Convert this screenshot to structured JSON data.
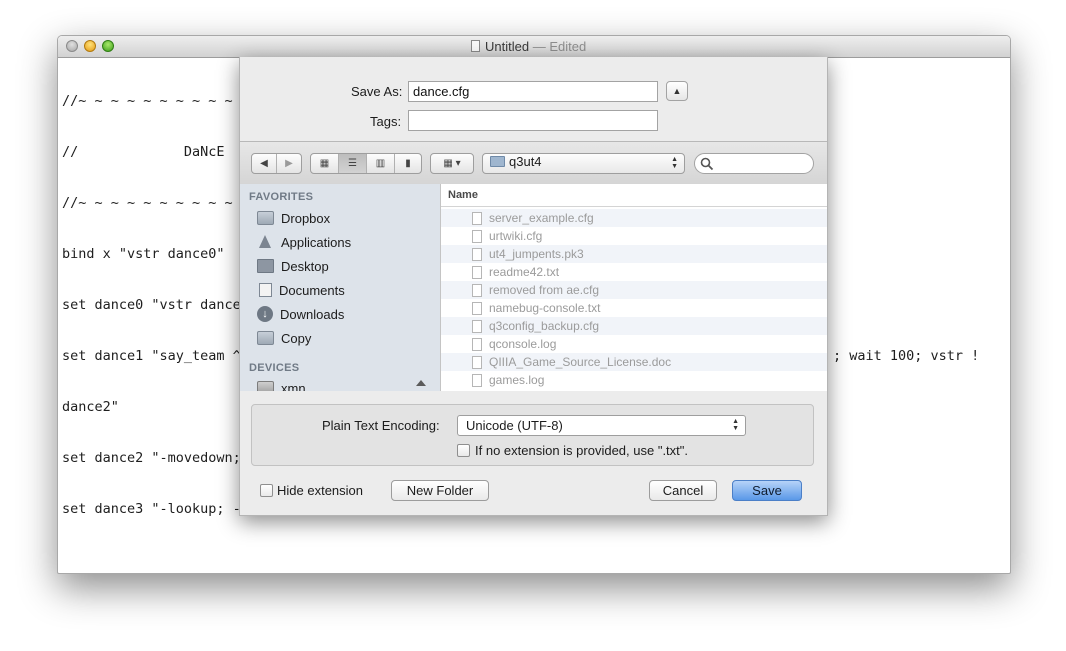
{
  "window": {
    "title": "Untitled",
    "title_separator": "—",
    "title_status": "Edited"
  },
  "editor": {
    "lines": [
      "//~ ~ ~ ~ ~ ~ ~ ~ ~ ~",
      "//             DaNcE",
      "//~ ~ ~ ~ ~ ~ ~ ~ ~ ~",
      "bind x \"vstr dance0\"",
      "set dance0 \"vstr dance",
      "set dance1 \"say_team ^",
      "dance2\"",
      "set dance2 \"-movedown;",
      "set dance3 \"-lookup; -"
    ],
    "dance1_tail": "; wait 100; vstr !"
  },
  "save_sheet": {
    "save_as_label": "Save As:",
    "save_as_value": "dance.cfg",
    "tags_label": "Tags:",
    "tags_value": "",
    "location": "q3ut4",
    "sidebar": {
      "favorites_header": "FAVORITES",
      "favorites": [
        {
          "label": "Dropbox",
          "icon": "folder-icon"
        },
        {
          "label": "Applications",
          "icon": "applications-icon"
        },
        {
          "label": "Desktop",
          "icon": "desktop-icon"
        },
        {
          "label": "Documents",
          "icon": "documents-icon"
        },
        {
          "label": "Downloads",
          "icon": "downloads-icon"
        },
        {
          "label": "Copy",
          "icon": "folder-icon"
        }
      ],
      "devices_header": "DEVICES",
      "devices": [
        {
          "label": "xmn",
          "icon": "disk-icon"
        }
      ]
    },
    "list_header": "Name",
    "files": [
      "server_example.cfg",
      "urtwiki.cfg",
      "ut4_jumpents.pk3",
      "readme42.txt",
      "removed from ae.cfg",
      "namebug-console.txt",
      "q3config_backup.cfg",
      "qconsole.log",
      "QIIIA_Game_Source_License.doc",
      "games.log"
    ],
    "encoding_label": "Plain Text Encoding:",
    "encoding_value": "Unicode (UTF-8)",
    "extension_check_label": "If no extension is provided, use \".txt\".",
    "hide_extension_label": "Hide extension",
    "new_folder_label": "New Folder",
    "cancel_label": "Cancel",
    "save_label": "Save"
  },
  "colors": {
    "accent": "#5a98e8",
    "sidebar_bg": "#dde3ea",
    "spell_error": "#e02020"
  }
}
